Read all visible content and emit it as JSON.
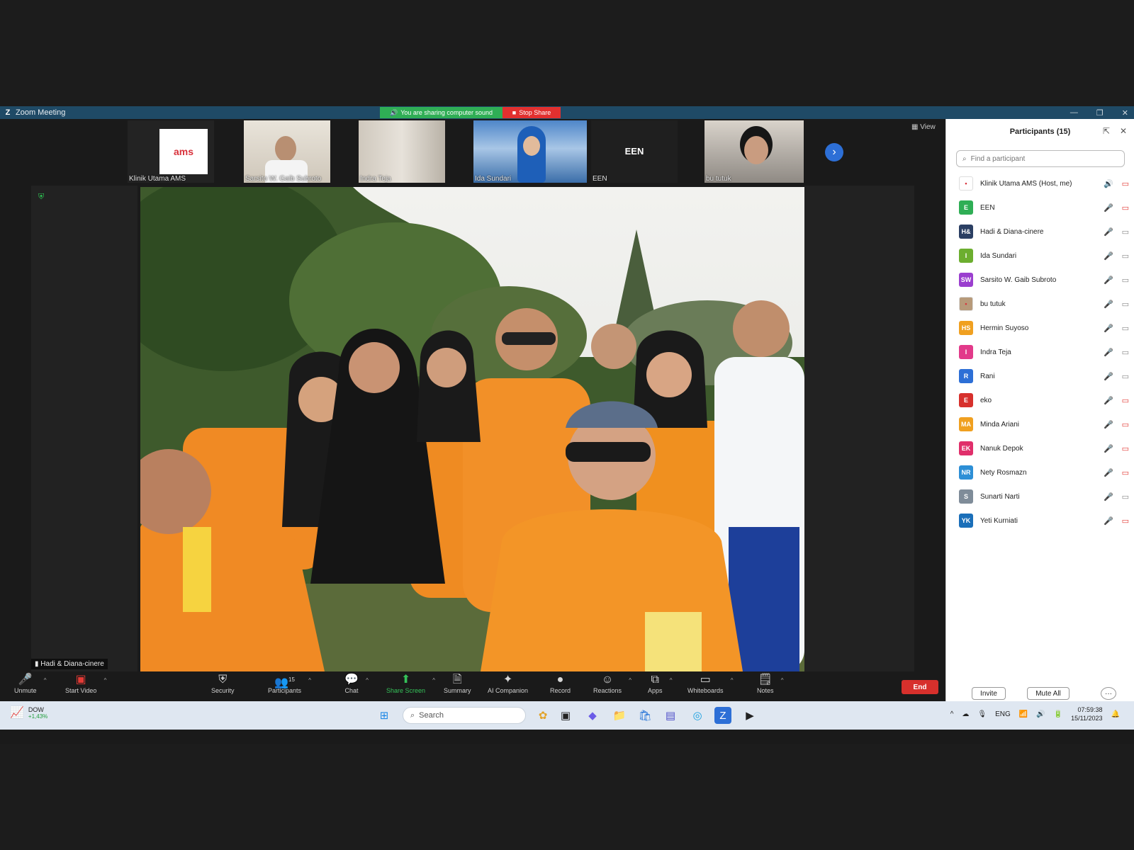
{
  "window": {
    "title": "Zoom Meeting",
    "sharing_notice": "You are sharing computer sound",
    "stop_share_label": "Stop Share"
  },
  "thumbnails": [
    {
      "name": "Klinik Utama AMS",
      "logo_text": "ams"
    },
    {
      "name": "Sarsito W. Gaib Subroto"
    },
    {
      "name": "Indra Teja"
    },
    {
      "name": "Ida Sundari"
    },
    {
      "name": "EEN",
      "big_name": "EEN"
    },
    {
      "name": "bu tutuk"
    }
  ],
  "view_label": "View",
  "active_speaker": "Hadi & Diana-cinere",
  "toolbar": {
    "unmute": "Unmute",
    "start_video": "Start Video",
    "security": "Security",
    "participants": "Participants",
    "participants_count": "15",
    "chat": "Chat",
    "share_screen": "Share Screen",
    "summary": "Summary",
    "ai_companion": "AI Companion",
    "record": "Record",
    "reactions": "Reactions",
    "apps": "Apps",
    "whiteboards": "Whiteboards",
    "notes": "Notes",
    "end": "End"
  },
  "panel": {
    "title": "Participants (15)",
    "search_placeholder": "Find a participant",
    "invite": "Invite",
    "mute_all": "Mute All",
    "more": "···",
    "participants": [
      {
        "initials": "",
        "name": "Klinik Utama AMS (Host, me)",
        "color": "#ffffff",
        "mic": "speaking",
        "cam": "off"
      },
      {
        "initials": "E",
        "name": "EEN",
        "color": "#2fae55",
        "mic": "on",
        "cam": "off"
      },
      {
        "initials": "H&",
        "name": "Hadi & Diana-cinere",
        "color": "#2b3f63",
        "mic": "on",
        "cam": "on"
      },
      {
        "initials": "I",
        "name": "Ida Sundari",
        "color": "#6cae2f",
        "mic": "on",
        "cam": "on"
      },
      {
        "initials": "SW",
        "name": "Sarsito W. Gaib Subroto",
        "color": "#9b3fcf",
        "mic": "on",
        "cam": "on"
      },
      {
        "initials": "",
        "name": "bu tutuk",
        "color": "#b79a7a",
        "mic": "on",
        "cam": "on"
      },
      {
        "initials": "HS",
        "name": "Hermin Suyoso",
        "color": "#f0a020",
        "mic": "on",
        "cam": "on"
      },
      {
        "initials": "I",
        "name": "Indra Teja",
        "color": "#e23a8a",
        "mic": "on",
        "cam": "on"
      },
      {
        "initials": "R",
        "name": "Rani",
        "color": "#2d6fd6",
        "mic": "on",
        "cam": "on"
      },
      {
        "initials": "E",
        "name": "eko",
        "color": "#d7302c",
        "mic": "off",
        "cam": "off"
      },
      {
        "initials": "MA",
        "name": "Minda Ariani",
        "color": "#f0a020",
        "mic": "off",
        "cam": "off"
      },
      {
        "initials": "EK",
        "name": "Nanuk Depok",
        "color": "#e02f6b",
        "mic": "off",
        "cam": "off"
      },
      {
        "initials": "NR",
        "name": "Nety Rosmazn",
        "color": "#2d8fd6",
        "mic": "off",
        "cam": "off"
      },
      {
        "initials": "S",
        "name": "Sunarti Narti",
        "color": "#7f8c99",
        "mic": "off",
        "cam": "on"
      },
      {
        "initials": "YK",
        "name": "Yeti Kurniati",
        "color": "#1b6fb9",
        "mic": "off",
        "cam": "off"
      }
    ]
  },
  "taskbar": {
    "stock_name": "DOW",
    "stock_change": "+1,43%",
    "search_placeholder": "Search",
    "lang": "ENG",
    "time": "07:59:38",
    "date": "15/11/2023"
  }
}
